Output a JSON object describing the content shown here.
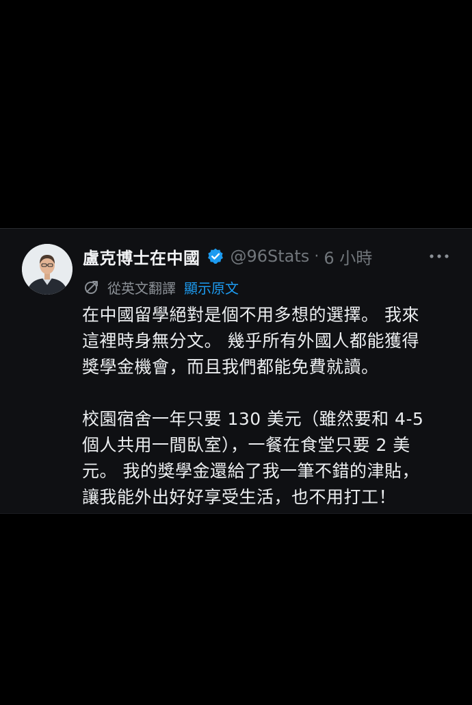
{
  "tweet": {
    "author_name": "盧克博士在中國",
    "handle": "@96Stats",
    "separator": "·",
    "time": "6 小時",
    "translated_from": "從英文翻譯",
    "show_original": "顯示原文",
    "paragraph1": [
      "在中國留學絕對是個不用多想的選擇。 我來",
      "這裡時身無分文。 幾乎所有外國人都能獲得",
      "獎學金機會，而且我們都能免費就讀。"
    ],
    "paragraph2": [
      "校園宿舍一年只要 130 美元（雖然要和 4-5",
      "個人共用一間臥室），一餐在食堂只要 2 美",
      "元。 我的獎學金還給了我一筆不錯的津貼，",
      "讓我能外出好好享受生活，也不用打工！"
    ]
  },
  "icons": {
    "verified": "verified-badge-icon",
    "more": "more-options-icon",
    "translate": "translate-icon",
    "avatar": "profile-photo"
  },
  "colors": {
    "background": "#000000",
    "card": "#0f1013",
    "accent": "#1d9bf0",
    "muted_text": "#71767b",
    "body_text": "#eceef0"
  }
}
